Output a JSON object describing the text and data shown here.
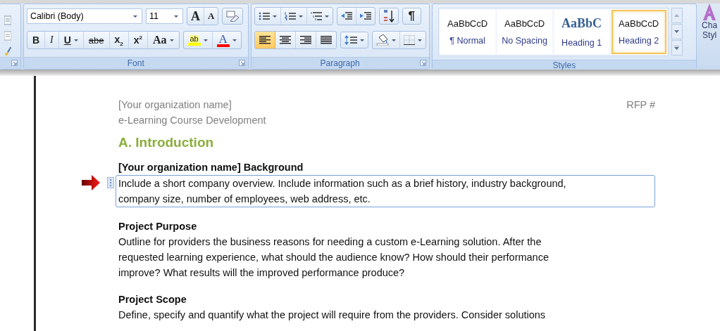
{
  "ribbon": {
    "font": {
      "font_name": "Calibri (Body)",
      "font_size": "11",
      "grow": "A",
      "shrink": "A",
      "format_buttons": [
        {
          "kind": "plain",
          "label": "B"
        },
        {
          "kind": "plain",
          "label": "I"
        },
        {
          "kind": "split",
          "label": "U"
        },
        {
          "kind": "plain",
          "label": "abe"
        },
        {
          "kind": "plain",
          "label": "x$_{2}$"
        },
        {
          "kind": "plain",
          "label": "x$^{2}$"
        },
        {
          "kind": "split",
          "label": "Aa"
        }
      ],
      "color_buttons": [
        {
          "label": "ab",
          "color": "#ffff00"
        },
        {
          "label": "A",
          "color": "#ff0000"
        }
      ],
      "label": "Font"
    },
    "paragraph": {
      "pilcrow": "¶",
      "alignments": [
        {
          "kind": "left",
          "selected": true
        },
        {
          "kind": "center",
          "selected": false
        },
        {
          "kind": "right",
          "selected": false
        },
        {
          "kind": "justify",
          "selected": false
        }
      ],
      "label": "Paragraph"
    },
    "styles": {
      "gallery": [
        {
          "preview": "AaBbCcD",
          "name": "¶ Normal",
          "kind": "body",
          "selected": false
        },
        {
          "preview": "AaBbCcD",
          "name": "No Spacing",
          "kind": "body",
          "selected": false
        },
        {
          "preview": "AaBbC",
          "name": "Heading 1",
          "kind": "heading",
          "selected": false
        },
        {
          "preview": "AaBbCcD",
          "name": "Heading 2",
          "kind": "body",
          "selected": true
        }
      ],
      "label": "Styles"
    },
    "change_styles": {
      "label": "Cha\nStyl"
    }
  },
  "document": {
    "header_left": "[Your organization name]",
    "header_right": "RFP #",
    "subtitle": "e-Learning Course Development",
    "heading": "A. Introduction",
    "sections": [
      {
        "title": "[Your organization name] Background",
        "text": "Include a short company overview. Include information such as a brief history, industry background,\ncompany size, number of employees, web address, etc.",
        "kind": "control"
      },
      {
        "title": "Project Purpose",
        "text": " Outline for providers the business reasons for needing a custom e-Learning solution. After the\nrequested learning experience, what should the audience know? How should their performance\nimprove? What results will the improved performance produce?",
        "kind": "plain"
      },
      {
        "title": "Project Scope",
        "text": "Define, specify and quantify what the project will require from the providers. Consider solutions",
        "kind": "plain"
      }
    ]
  }
}
